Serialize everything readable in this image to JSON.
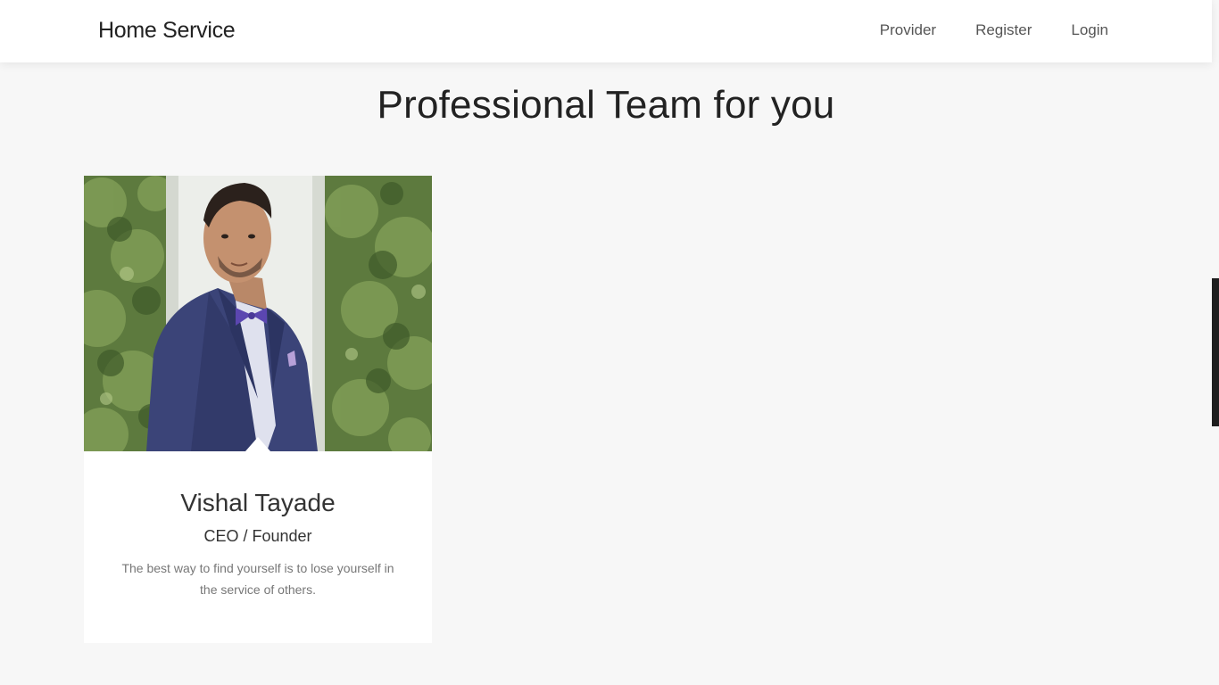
{
  "navbar": {
    "brand": "Home Service",
    "links": [
      {
        "label": "Provider"
      },
      {
        "label": "Register"
      },
      {
        "label": "Login"
      }
    ]
  },
  "team_section": {
    "title": "Professional Team for you",
    "members": [
      {
        "name": "Vishal Tayade",
        "role": "CEO / Founder",
        "quote": "The best way to find yourself is to lose yourself in the service of others."
      }
    ]
  },
  "colors": {
    "page_background": "#f7f7f7",
    "card_background": "#ffffff",
    "text_dark": "#222222",
    "text_muted": "#777777"
  }
}
